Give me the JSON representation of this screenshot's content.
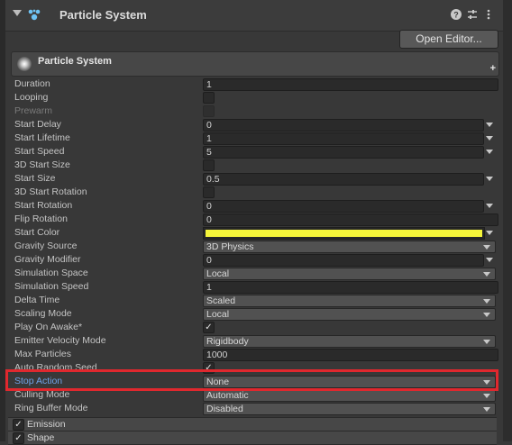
{
  "header": {
    "title": "Particle System",
    "icons": [
      "help-icon",
      "settings-sliders-icon",
      "more-vertical-icon"
    ]
  },
  "open_editor_label": "Open Editor...",
  "module": {
    "title": "Particle System",
    "add_label": "+"
  },
  "properties": [
    {
      "label": "Duration",
      "kind": "field",
      "value": "1"
    },
    {
      "label": "Looping",
      "kind": "checkbox",
      "checked": false
    },
    {
      "label": "Prewarm",
      "kind": "checkbox",
      "checked": false,
      "disabled": true
    },
    {
      "label": "Start Delay",
      "kind": "field_menu",
      "value": "0"
    },
    {
      "label": "Start Lifetime",
      "kind": "field_menu",
      "value": "1"
    },
    {
      "label": "Start Speed",
      "kind": "field_menu",
      "value": "5"
    },
    {
      "label": "3D Start Size",
      "kind": "checkbox",
      "checked": false
    },
    {
      "label": "Start Size",
      "kind": "field_menu",
      "value": "0.5"
    },
    {
      "label": "3D Start Rotation",
      "kind": "checkbox",
      "checked": false
    },
    {
      "label": "Start Rotation",
      "kind": "field_menu",
      "value": "0"
    },
    {
      "label": "Flip Rotation",
      "kind": "field",
      "value": "0"
    },
    {
      "label": "Start Color",
      "kind": "color",
      "color": "#f5f53a"
    },
    {
      "label": "Gravity Source",
      "kind": "dropdown",
      "value": "3D Physics"
    },
    {
      "label": "Gravity Modifier",
      "kind": "field_menu",
      "value": "0"
    },
    {
      "label": "Simulation Space",
      "kind": "dropdown",
      "value": "Local"
    },
    {
      "label": "Simulation Speed",
      "kind": "field",
      "value": "1"
    },
    {
      "label": "Delta Time",
      "kind": "dropdown",
      "value": "Scaled"
    },
    {
      "label": "Scaling Mode",
      "kind": "dropdown",
      "value": "Local"
    },
    {
      "label": "Play On Awake*",
      "kind": "checkbox",
      "checked": true
    },
    {
      "label": "Emitter Velocity Mode",
      "kind": "dropdown",
      "value": "Rigidbody"
    },
    {
      "label": "Max Particles",
      "kind": "field",
      "value": "1000"
    },
    {
      "label": "Auto Random Seed",
      "kind": "checkbox",
      "checked": true
    },
    {
      "label": "Stop Action",
      "kind": "dropdown",
      "value": "None",
      "highlighted": true
    },
    {
      "label": "Culling Mode",
      "kind": "dropdown",
      "value": "Automatic"
    },
    {
      "label": "Ring Buffer Mode",
      "kind": "dropdown",
      "value": "Disabled"
    }
  ],
  "modules": [
    {
      "label": "Emission",
      "enabled": true
    },
    {
      "label": "Shape",
      "enabled": true
    }
  ],
  "colors": {
    "highlight": "#e0282e",
    "stop_action_label": "#6fa3e8",
    "start_color": "#f5f53a"
  }
}
